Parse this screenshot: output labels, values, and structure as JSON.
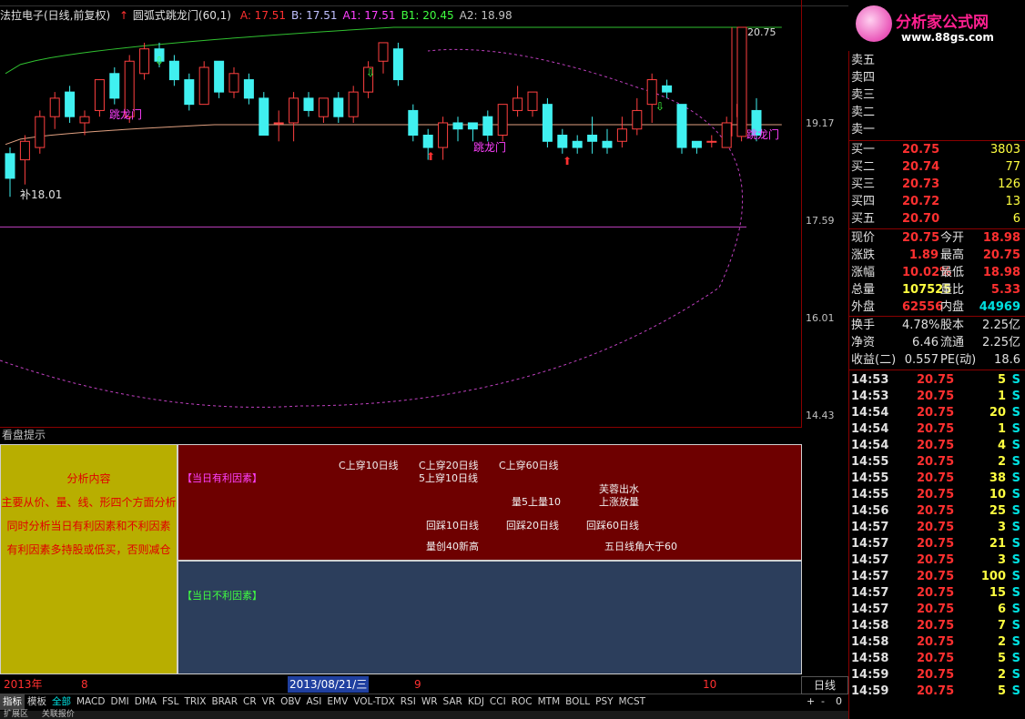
{
  "window": {
    "title": "法拉电子(日线,前复权)",
    "indicator": "圆弧式跳龙门(60,1)",
    "params": [
      {
        "label": "A: 17.51",
        "color": "#ff3030"
      },
      {
        "label": "B: 17.51",
        "color": "#c0c0ff"
      },
      {
        "label": "A1: 17.51",
        "color": "#ff40ff"
      },
      {
        "label": "B1: 20.45",
        "color": "#40ff40"
      },
      {
        "label": "A2: 18.98",
        "color": "#c0c0c0"
      }
    ]
  },
  "chart": {
    "price_labels": [
      "20.75",
      "19.17",
      "17.59",
      "16.01",
      "14.43"
    ],
    "high_label": "20.75",
    "low_label": "18.01",
    "low_prefix": "补",
    "jump_label_left": "跳龙门",
    "jump_label_mid": "跳龙门",
    "jump_label_right": "跳龙门"
  },
  "hint": {
    "title": "看盘提示",
    "left": [
      "分析内容",
      "主要从价、量、线、形四个方面分析",
      "同时分析当日有利因素和不利因素",
      "有利因素多持股或低买，否则减仓"
    ],
    "favorable_title": "【当日有利因素】",
    "favorable": [
      "C上穿10日线",
      "C上穿20日线",
      "C上穿60日线",
      "5上穿10日线",
      "芙蓉出水",
      "量5上量10",
      "上涨放量",
      "回踩10日线",
      "回踩20日线",
      "回踩60日线",
      "量创40新高",
      "五日线角大于60"
    ],
    "unfavorable_title": "【当日不利因素】"
  },
  "xaxis": {
    "year": "2013年",
    "m8": "8",
    "date": "2013/08/21/三",
    "m9": "9",
    "m10": "10"
  },
  "period": "日线",
  "zoom": [
    "+",
    "-",
    "0"
  ],
  "tabs": [
    "指标",
    "模板",
    "全部",
    "MACD",
    "DMI",
    "DMA",
    "FSL",
    "TRIX",
    "BRAR",
    "CR",
    "VR",
    "OBV",
    "ASI",
    "EMV",
    "VOL-TDX",
    "RSI",
    "WR",
    "SAR",
    "KDJ",
    "CCI",
    "ROC",
    "MTM",
    "BOLL",
    "PSY",
    "MCST"
  ],
  "bottom": [
    "扩展区",
    "关联报价"
  ],
  "logo": {
    "text": "分析家公式网",
    "url": "www.88gs.com"
  },
  "orderbook": {
    "sell": [
      "卖五",
      "卖四",
      "卖三",
      "卖二",
      "卖一"
    ],
    "buy": [
      {
        "label": "买一",
        "price": "20.75",
        "vol": "3803"
      },
      {
        "label": "买二",
        "price": "20.74",
        "vol": "77"
      },
      {
        "label": "买三",
        "price": "20.73",
        "vol": "126"
      },
      {
        "label": "买四",
        "price": "20.72",
        "vol": "13"
      },
      {
        "label": "买五",
        "price": "20.70",
        "vol": "6"
      }
    ]
  },
  "quote": [
    {
      "l1": "现价",
      "v1": "20.75",
      "c1": "red",
      "l2": "今开",
      "v2": "18.98",
      "c2": "red"
    },
    {
      "l1": "涨跌",
      "v1": "1.89",
      "c1": "red",
      "l2": "最高",
      "v2": "20.75",
      "c2": "red"
    },
    {
      "l1": "涨幅",
      "v1": "10.02%",
      "c1": "red",
      "l2": "最低",
      "v2": "18.98",
      "c2": "red"
    },
    {
      "l1": "总量",
      "v1": "107525",
      "c1": "yel",
      "l2": "量比",
      "v2": "5.33",
      "c2": "red"
    },
    {
      "l1": "外盘",
      "v1": "62556",
      "c1": "red",
      "l2": "内盘",
      "v2": "44969",
      "c2": "grn"
    }
  ],
  "finance": [
    {
      "l1": "换手",
      "v1": "4.78%",
      "l2": "股本",
      "v2": "2.25亿"
    },
    {
      "l1": "净资",
      "v1": "6.46",
      "l2": "流通",
      "v2": "2.25亿"
    },
    {
      "l1": "收益(二)",
      "v1": "0.557",
      "l2": "PE(动)",
      "v2": "18.6"
    }
  ],
  "ticks": [
    {
      "t": "14:53",
      "p": "20.75",
      "v": "5",
      "s": "S"
    },
    {
      "t": "14:53",
      "p": "20.75",
      "v": "1",
      "s": "S"
    },
    {
      "t": "14:54",
      "p": "20.75",
      "v": "20",
      "s": "S"
    },
    {
      "t": "14:54",
      "p": "20.75",
      "v": "1",
      "s": "S"
    },
    {
      "t": "14:54",
      "p": "20.75",
      "v": "4",
      "s": "S"
    },
    {
      "t": "14:55",
      "p": "20.75",
      "v": "2",
      "s": "S"
    },
    {
      "t": "14:55",
      "p": "20.75",
      "v": "38",
      "s": "S"
    },
    {
      "t": "14:55",
      "p": "20.75",
      "v": "10",
      "s": "S"
    },
    {
      "t": "14:56",
      "p": "20.75",
      "v": "25",
      "s": "S"
    },
    {
      "t": "14:57",
      "p": "20.75",
      "v": "3",
      "s": "S"
    },
    {
      "t": "14:57",
      "p": "20.75",
      "v": "21",
      "s": "S"
    },
    {
      "t": "14:57",
      "p": "20.75",
      "v": "3",
      "s": "S"
    },
    {
      "t": "14:57",
      "p": "20.75",
      "v": "100",
      "s": "S"
    },
    {
      "t": "14:57",
      "p": "20.75",
      "v": "15",
      "s": "S"
    },
    {
      "t": "14:57",
      "p": "20.75",
      "v": "6",
      "s": "S"
    },
    {
      "t": "14:58",
      "p": "20.75",
      "v": "7",
      "s": "S"
    },
    {
      "t": "14:58",
      "p": "20.75",
      "v": "2",
      "s": "S"
    },
    {
      "t": "14:58",
      "p": "20.75",
      "v": "5",
      "s": "S"
    },
    {
      "t": "14:59",
      "p": "20.75",
      "v": "2",
      "s": "S"
    },
    {
      "t": "14:59",
      "p": "20.75",
      "v": "5",
      "s": "S"
    }
  ],
  "candles": [
    {
      "o": 18.7,
      "c": 18.3,
      "h": 18.8,
      "l": 18.0
    },
    {
      "o": 18.6,
      "c": 18.9,
      "h": 19.0,
      "l": 18.2
    },
    {
      "o": 18.8,
      "c": 19.3,
      "h": 19.4,
      "l": 18.7
    },
    {
      "o": 19.3,
      "c": 19.6,
      "h": 19.7,
      "l": 19.1
    },
    {
      "o": 19.7,
      "c": 19.3,
      "h": 19.8,
      "l": 19.2
    },
    {
      "o": 19.2,
      "c": 19.3,
      "h": 19.4,
      "l": 19.0
    },
    {
      "o": 19.4,
      "c": 19.9,
      "h": 19.9,
      "l": 19.3
    },
    {
      "o": 20.0,
      "c": 19.6,
      "h": 20.1,
      "l": 19.5
    },
    {
      "o": 19.3,
      "c": 20.2,
      "h": 20.3,
      "l": 19.2
    },
    {
      "o": 20.0,
      "c": 20.4,
      "h": 20.5,
      "l": 19.9
    },
    {
      "o": 20.4,
      "c": 20.2,
      "h": 20.5,
      "l": 20.1
    },
    {
      "o": 20.2,
      "c": 19.9,
      "h": 20.3,
      "l": 19.8
    },
    {
      "o": 19.9,
      "c": 19.5,
      "h": 20.0,
      "l": 19.4
    },
    {
      "o": 19.5,
      "c": 20.1,
      "h": 20.2,
      "l": 19.5
    },
    {
      "o": 20.2,
      "c": 19.7,
      "h": 20.2,
      "l": 19.6
    },
    {
      "o": 19.7,
      "c": 20.0,
      "h": 20.1,
      "l": 19.6
    },
    {
      "o": 19.9,
      "c": 19.6,
      "h": 20.0,
      "l": 19.5
    },
    {
      "o": 19.6,
      "c": 19.0,
      "h": 19.7,
      "l": 19.0
    },
    {
      "o": 19.2,
      "c": 19.2,
      "h": 19.4,
      "l": 18.9
    },
    {
      "o": 19.2,
      "c": 19.6,
      "h": 19.7,
      "l": 18.9
    },
    {
      "o": 19.6,
      "c": 19.4,
      "h": 19.7,
      "l": 19.3
    },
    {
      "o": 19.3,
      "c": 19.6,
      "h": 19.6,
      "l": 19.2
    },
    {
      "o": 19.6,
      "c": 19.3,
      "h": 19.7,
      "l": 19.2
    },
    {
      "o": 19.3,
      "c": 19.7,
      "h": 19.8,
      "l": 19.2
    },
    {
      "o": 19.7,
      "c": 20.1,
      "h": 20.2,
      "l": 19.6
    },
    {
      "o": 20.2,
      "c": 20.5,
      "h": 20.5,
      "l": 20.0
    },
    {
      "o": 20.4,
      "c": 19.9,
      "h": 20.5,
      "l": 19.8
    },
    {
      "o": 19.4,
      "c": 19.0,
      "h": 19.5,
      "l": 18.9
    },
    {
      "o": 19.0,
      "c": 18.8,
      "h": 19.1,
      "l": 18.6
    },
    {
      "o": 18.8,
      "c": 19.2,
      "h": 19.3,
      "l": 18.6
    },
    {
      "o": 19.2,
      "c": 19.1,
      "h": 19.3,
      "l": 18.9
    },
    {
      "o": 19.2,
      "c": 19.1,
      "h": 19.2,
      "l": 18.9
    },
    {
      "o": 19.3,
      "c": 19.0,
      "h": 19.4,
      "l": 18.9
    },
    {
      "o": 19.0,
      "c": 19.5,
      "h": 19.5,
      "l": 18.9
    },
    {
      "o": 19.4,
      "c": 19.6,
      "h": 19.8,
      "l": 19.3
    },
    {
      "o": 19.4,
      "c": 19.7,
      "h": 19.7,
      "l": 19.3
    },
    {
      "o": 19.5,
      "c": 18.9,
      "h": 19.6,
      "l": 18.8
    },
    {
      "o": 19.0,
      "c": 18.8,
      "h": 19.1,
      "l": 18.7
    },
    {
      "o": 18.9,
      "c": 18.8,
      "h": 19.0,
      "l": 18.7
    },
    {
      "o": 19.0,
      "c": 18.9,
      "h": 19.3,
      "l": 18.7
    },
    {
      "o": 18.9,
      "c": 18.8,
      "h": 19.1,
      "l": 18.7
    },
    {
      "o": 18.9,
      "c": 19.1,
      "h": 19.3,
      "l": 18.8
    },
    {
      "o": 19.1,
      "c": 19.4,
      "h": 19.6,
      "l": 19.0
    },
    {
      "o": 19.5,
      "c": 19.9,
      "h": 20.0,
      "l": 19.2
    },
    {
      "o": 19.8,
      "c": 19.7,
      "h": 19.9,
      "l": 19.6
    },
    {
      "o": 19.5,
      "c": 18.8,
      "h": 19.5,
      "l": 18.7
    },
    {
      "o": 18.9,
      "c": 18.8,
      "h": 18.9,
      "l": 18.7
    },
    {
      "o": 18.9,
      "c": 18.9,
      "h": 19.0,
      "l": 18.8
    },
    {
      "o": 18.8,
      "c": 19.2,
      "h": 19.3,
      "l": 18.8
    },
    {
      "o": 19.3,
      "c": 19.5,
      "h": 19.6,
      "l": 18.9
    },
    {
      "o": 19.4,
      "c": 19.0,
      "h": 19.6,
      "l": 18.9
    },
    {
      "o": 18.98,
      "c": 20.75,
      "h": 20.75,
      "l": 18.98
    }
  ]
}
